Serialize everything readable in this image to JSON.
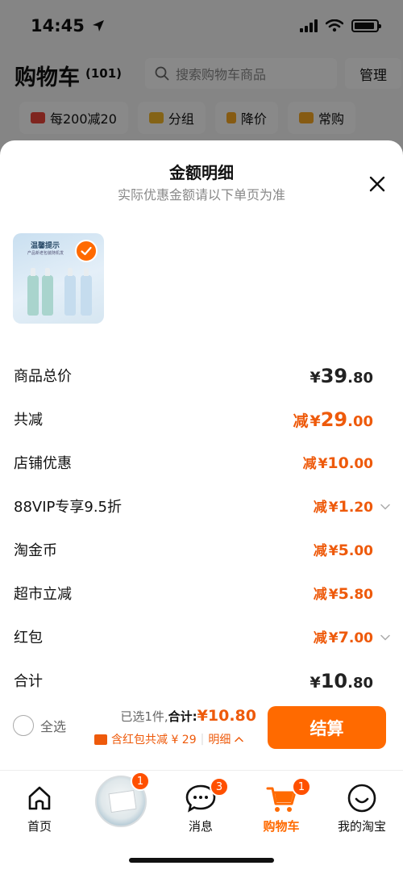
{
  "status_bar": {
    "time": "14:45"
  },
  "cart": {
    "title": "购物车",
    "count": "(101)",
    "search_placeholder": "搜索购物车商品",
    "manage_label": "管理",
    "filters": [
      {
        "label": "每200减20",
        "icon": "coupon-icon",
        "color": "#e8443a"
      },
      {
        "label": "分组",
        "icon": "folder-icon",
        "color": "#f0b429"
      },
      {
        "label": "降价",
        "icon": "arrow-down-icon",
        "color": "#f5a623"
      },
      {
        "label": "常购",
        "icon": "cart-icon",
        "color": "#f5a623"
      }
    ]
  },
  "sheet": {
    "title": "金额明细",
    "subtitle": "实际优惠金额请以下单页为准",
    "product_thumb": {
      "banner": "温馨提示",
      "sub": "产品新老包装随机发"
    },
    "rows": [
      {
        "label": "商品总价",
        "prefix": "",
        "currency": "¥",
        "int": "39",
        "dec": ".80",
        "style": "dark-big",
        "chevron": false
      },
      {
        "label": "共减",
        "prefix": "减",
        "currency": "¥",
        "int": "29",
        "dec": ".00",
        "style": "orange-big",
        "chevron": false
      },
      {
        "label": "店铺优惠",
        "prefix": "减",
        "currency": "¥",
        "int": "10",
        "dec": ".00",
        "style": "orange-small",
        "chevron": false
      },
      {
        "label": "88VIP专享9.5折",
        "prefix": "减",
        "currency": "¥",
        "int": "1",
        "dec": ".20",
        "style": "orange-small",
        "chevron": true
      },
      {
        "label": "淘金币",
        "prefix": "减",
        "currency": "¥",
        "int": "5",
        "dec": ".00",
        "style": "orange-small",
        "chevron": false
      },
      {
        "label": "超市立减",
        "prefix": "减",
        "currency": "¥",
        "int": "5",
        "dec": ".80",
        "style": "orange-small",
        "chevron": false
      },
      {
        "label": "红包",
        "prefix": "减",
        "currency": "¥",
        "int": "7",
        "dec": ".00",
        "style": "orange-small",
        "chevron": true
      },
      {
        "label": "合计",
        "prefix": "",
        "currency": "¥",
        "int": "10",
        "dec": ".80",
        "style": "dark-big",
        "chevron": false
      }
    ]
  },
  "checkout": {
    "select_all": "全选",
    "selected": "已选1件,",
    "total_label": "合计:",
    "total_value": "¥10.80",
    "redpack_note": "含红包共减 ¥ 29",
    "detail_label": "明细",
    "button": "结算"
  },
  "tabbar": {
    "tabs": [
      {
        "label": "首页",
        "icon": "home-icon",
        "badge": ""
      },
      {
        "label": "",
        "icon": "product-avatar",
        "badge": "1"
      },
      {
        "label": "消息",
        "icon": "message-icon",
        "badge": "3"
      },
      {
        "label": "购物车",
        "icon": "cart-icon",
        "badge": "1"
      },
      {
        "label": "我的淘宝",
        "icon": "profile-icon",
        "badge": ""
      }
    ]
  },
  "colors": {
    "accent": "#ff6a00",
    "discount": "#ee5a0b"
  }
}
